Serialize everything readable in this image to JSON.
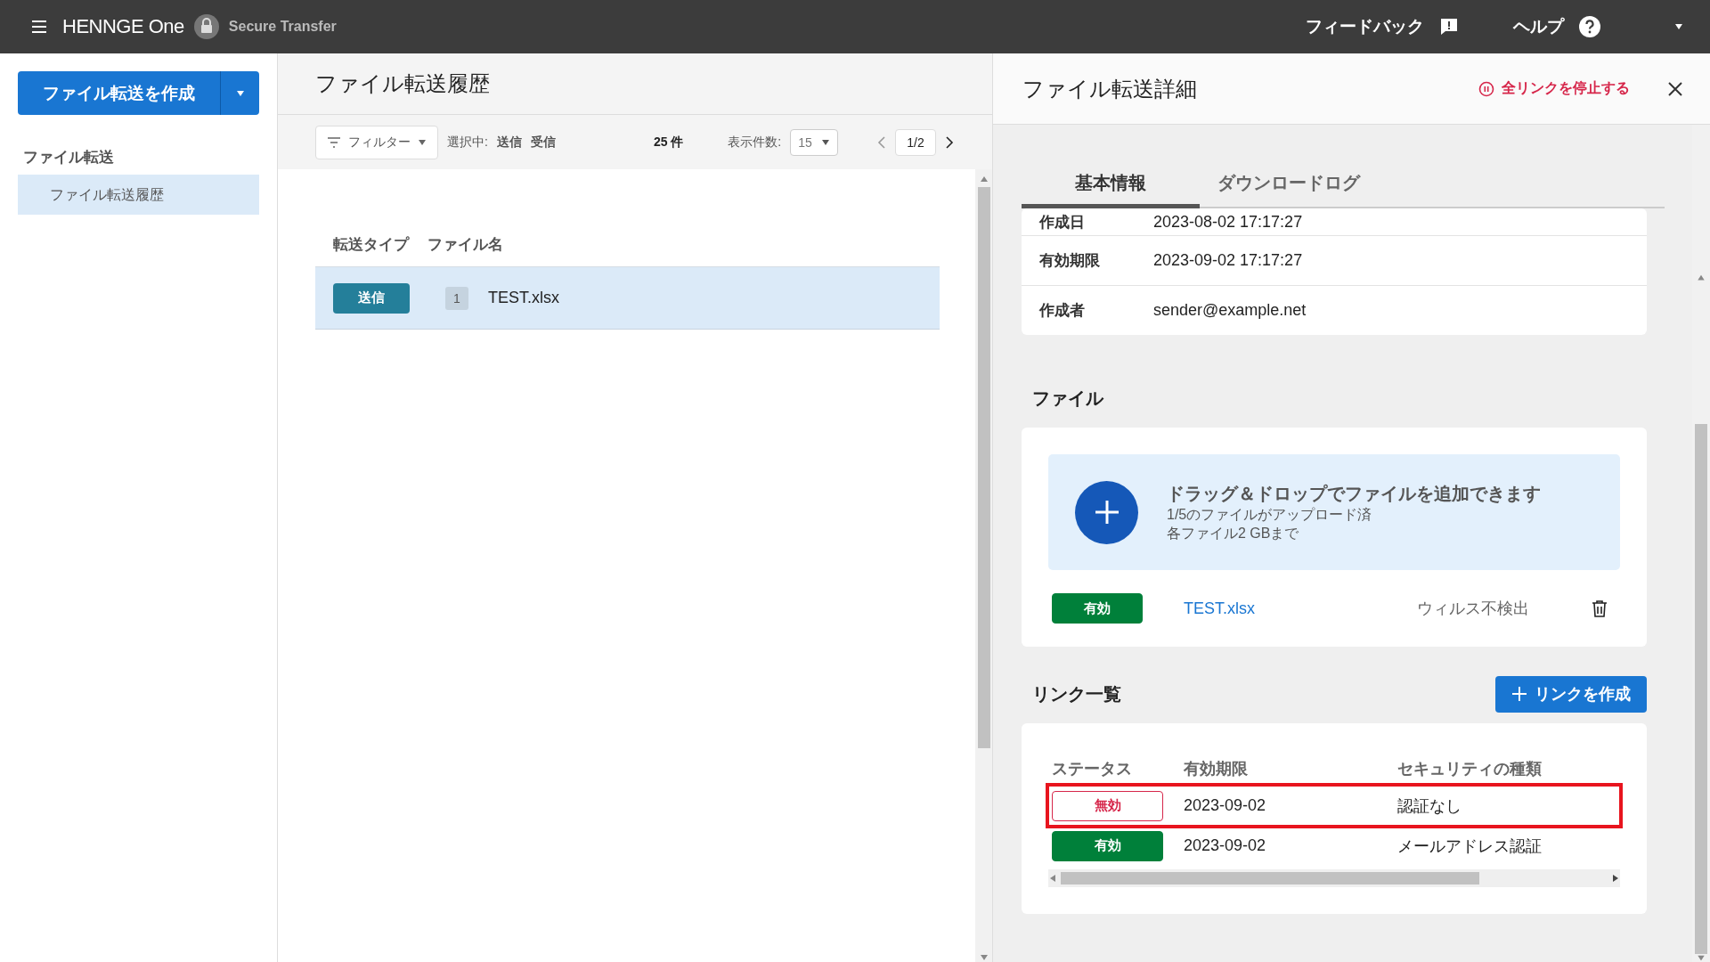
{
  "header": {
    "brand": "HENNGE One",
    "product": "Secure Transfer",
    "feedback": "フィードバック",
    "help": "ヘルプ"
  },
  "sidebar": {
    "create_button": "ファイル転送を作成",
    "section": "ファイル転送",
    "items": [
      {
        "label": "ファイル転送履歴",
        "selected": true
      }
    ]
  },
  "history": {
    "title": "ファイル転送履歴",
    "filter": "フィルター",
    "selected_label": "選択中:",
    "selected_filters": [
      "送信",
      "受信"
    ],
    "count": "25 件",
    "per_page_label": "表示件数:",
    "per_page": "15",
    "page": "1/2",
    "columns": [
      "転送タイプ",
      "ファイル名"
    ],
    "rows": [
      {
        "type": "送信",
        "file_count": "1",
        "file_name": "TEST.xlsx",
        "selected": true
      }
    ]
  },
  "detail": {
    "title": "ファイル転送詳細",
    "stop_all": "全リンクを停止する",
    "tabs": [
      {
        "label": "基本情報",
        "selected": true
      },
      {
        "label": "ダウンロードログ",
        "selected": false
      }
    ],
    "info": [
      {
        "label": "作成日",
        "value": "2023-08-02 17:17:27"
      },
      {
        "label": "有効期限",
        "value": "2023-09-02 17:17:27"
      },
      {
        "label": "作成者",
        "value": "sender@example.net"
      }
    ],
    "files_title": "ファイル",
    "dropzone": {
      "title": "ドラッグ＆ドロップでファイルを追加できます",
      "lines": [
        "1/5のファイルがアップロード済",
        "各ファイル2 GBまで"
      ]
    },
    "files": [
      {
        "status": "有効",
        "active": true,
        "name": "TEST.xlsx",
        "scan": "ウィルス不検出"
      }
    ],
    "links_title": "リンク一覧",
    "create_link": "リンクを作成",
    "link_columns": [
      "ステータス",
      "有効期限",
      "セキュリティの種類"
    ],
    "links": [
      {
        "status": "無効",
        "active": false,
        "expiry": "2023-09-02",
        "security": "認証なし",
        "highlighted": true
      },
      {
        "status": "有効",
        "active": true,
        "expiry": "2023-09-02",
        "security": "メールアドレス認証",
        "highlighted": false
      }
    ]
  }
}
